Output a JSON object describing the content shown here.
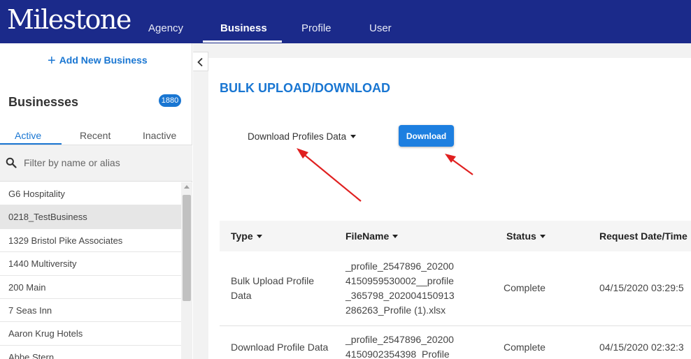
{
  "nav": {
    "logo": "Milestone",
    "items": [
      "Agency",
      "Business",
      "Profile",
      "User"
    ],
    "active": "Business"
  },
  "sidebar": {
    "add_label": "Add New Business",
    "title": "Businesses",
    "count": "1880",
    "tabs": [
      "Active",
      "Recent",
      "Inactive"
    ],
    "filter_placeholder": "Filter by name or alias",
    "items": [
      "G6 Hospitality",
      "0218_TestBusiness",
      "1329 Bristol Pike Associates",
      "1440 Multiversity",
      "200 Main",
      "7 Seas Inn",
      "Aaron Krug Hotels",
      "Abbe Stern"
    ],
    "selected_index": 1
  },
  "main": {
    "title": "BULK UPLOAD/DOWNLOAD",
    "select_label": "Download Profiles Data",
    "download_button": "Download",
    "table": {
      "headers": [
        "Type",
        "FileName",
        "Status",
        "Request Date/Time"
      ],
      "rows": [
        {
          "type": [
            "Bulk Upload Profile",
            "Data"
          ],
          "filename": [
            "_profile_2547896_20200",
            "4150959530002__profile",
            "_365798_202004150913",
            "286263_Profile (1).xlsx"
          ],
          "status": "Complete",
          "date": "04/15/2020 03:29:5"
        },
        {
          "type": [
            "Download Profile Data"
          ],
          "filename": [
            "_profile_2547896_20200",
            "4150902354398_Profile"
          ],
          "status": "Complete",
          "date": "04/15/2020 02:32:3"
        }
      ]
    }
  },
  "colors": {
    "nav_bg": "#1b2a8a",
    "accent": "#1976d2",
    "annotation": "#e02020"
  }
}
